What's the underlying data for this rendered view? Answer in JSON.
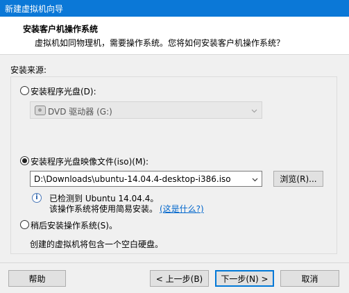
{
  "window": {
    "title": "新建虚拟机向导"
  },
  "header": {
    "title": "安装客户机操作系统",
    "subtitle": "虚拟机如同物理机，需要操作系统。您将如何安装客户机操作系统？"
  },
  "install_source": {
    "group_label": "安装来源:",
    "options": [
      {
        "label": "安装程序光盘(D):",
        "selected": false
      },
      {
        "label": "安装程序光盘映像文件(iso)(M):",
        "selected": true
      },
      {
        "label": "稍后安装操作系统(S)。",
        "selected": false
      }
    ],
    "disc_drive": {
      "value": "DVD 驱动器 (G:)",
      "enabled": false
    },
    "iso_path": {
      "value": "D:\\Downloads\\ubuntu-14.04.4-desktop-i386.iso"
    },
    "browse_label": "浏览(R)...",
    "detected_text": "已检测到 Ubuntu 14.04.4。",
    "easy_install_text": "该操作系统将使用简易安装。",
    "what_is_link": "(这是什么?)",
    "later_description": "创建的虚拟机将包含一个空白硬盘。"
  },
  "footer": {
    "help_label": "帮助",
    "back_label": "< 上一步(B)",
    "next_label": "下一步(N) >",
    "cancel_label": "取消"
  },
  "colors": {
    "titlebar": "#0b78d7",
    "accent": "#0078d7",
    "link": "#0066cc"
  },
  "icons": {
    "disc": "dvd-drive-icon",
    "info": "info-icon",
    "dropdown": "chevron-down-icon"
  }
}
